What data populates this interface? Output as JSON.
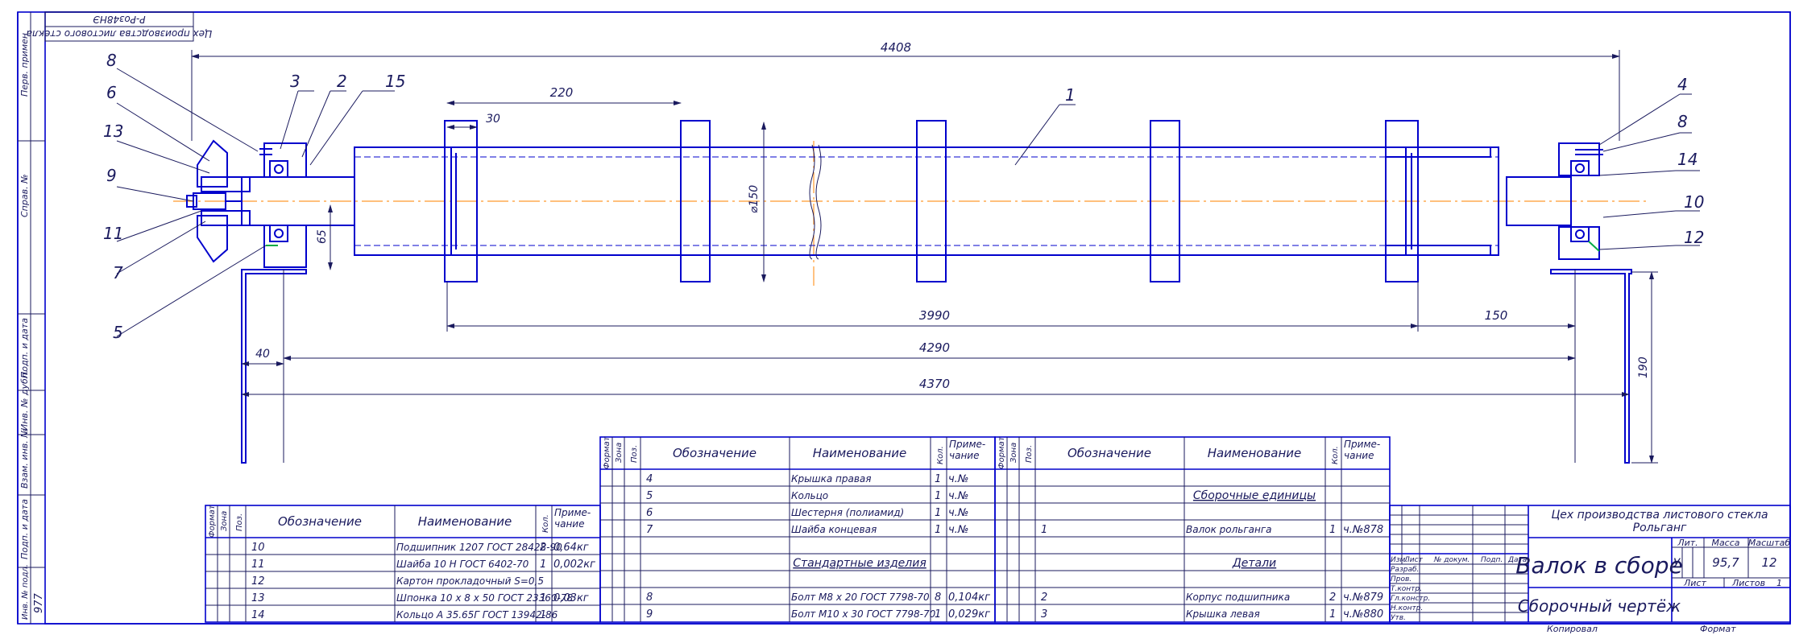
{
  "frame": {
    "top_stamp_line1": "Р-Роз48НЭ",
    "top_stamp_line2": "Цех производства листового стекла",
    "side_labels": [
      "Перв. примен",
      "Справ. №",
      "Подп. и дата",
      "Инв. № дубл.",
      "Взам. инв. №",
      "Подп. и дата",
      "Инв. № подл."
    ],
    "side_value": "977"
  },
  "dimensions": {
    "d4408": "4408",
    "d220": "220",
    "d30": "30",
    "d150dia": "⌀150",
    "d65": "65",
    "d3990": "3990",
    "d150": "150",
    "d40": "40",
    "d4290": "4290",
    "d4370": "4370",
    "d190": "190"
  },
  "callouts": {
    "c1": "1",
    "c2": "2",
    "c3": "3",
    "c4": "4",
    "c5": "5",
    "c6": "6",
    "c7": "7",
    "c8a": "8",
    "c8b": "8",
    "c9": "9",
    "c10": "10",
    "c11": "11",
    "c12": "12",
    "c13": "13",
    "c14": "14",
    "c15": "15"
  },
  "spec_left": {
    "headers": {
      "format": "Формат",
      "zone": "Зона",
      "pos": "Поз.",
      "designation": "Обозначение",
      "name": "Наименование",
      "qty": "Кол.",
      "note": "Приме-чание"
    },
    "rows": [
      {
        "pos": "10",
        "name": "Подшипник 1207 ГОСТ 28428-90",
        "qty": "2",
        "note": "0,64кг"
      },
      {
        "pos": "11",
        "name": "Шайба 10 Н ГОСТ 6402-70",
        "qty": "1",
        "note": "0,002кг"
      },
      {
        "pos": "12",
        "name": "Картон прокладочный S=0,5",
        "qty": "",
        "note": ""
      },
      {
        "pos": "13",
        "name": "Шпонка 10 x 8 x 50 ГОСТ 23360-78",
        "qty": "1",
        "note": "0,03кг"
      },
      {
        "pos": "14",
        "name": "Кольцо А 35.65Г ГОСТ 13942-86",
        "qty": "1",
        "note": ""
      }
    ]
  },
  "spec_mid": {
    "headers": {
      "format": "Формат",
      "zone": "Зона",
      "pos": "Поз.",
      "designation": "Обозначение",
      "name": "Наименование",
      "qty": "Кол.",
      "note": "Приме-чание"
    },
    "rows": [
      {
        "pos": "4",
        "name": "Крышка правая",
        "qty": "1",
        "note": "ч.№"
      },
      {
        "pos": "5",
        "name": "Кольцо",
        "qty": "1",
        "note": "ч.№"
      },
      {
        "pos": "6",
        "name": "Шестерня (полиамид)",
        "qty": "1",
        "note": "ч.№"
      },
      {
        "pos": "7",
        "name": "Шайба концевая",
        "qty": "1",
        "note": "ч.№"
      },
      {
        "pos": "",
        "name": "",
        "qty": "",
        "note": ""
      },
      {
        "pos": "",
        "name": "Стандартные изделия",
        "qty": "",
        "note": ""
      },
      {
        "pos": "",
        "name": "",
        "qty": "",
        "note": ""
      },
      {
        "pos": "8",
        "name": "Болт М8 x 20 ГОСТ 7798-70",
        "qty": "8",
        "note": "0,104кг"
      },
      {
        "pos": "9",
        "name": "Болт М10 x 30 ГОСТ 7798-70",
        "qty": "1",
        "note": "0,029кг"
      }
    ]
  },
  "spec_right": {
    "headers": {
      "format": "Формат",
      "zone": "Зона",
      "pos": "Поз.",
      "designation": "Обозначение",
      "name": "Наименование",
      "qty": "Кол.",
      "note": "Приме-чание"
    },
    "rows": [
      {
        "pos": "",
        "name": "",
        "qty": "",
        "note": ""
      },
      {
        "pos": "",
        "name": "Сборочные единицы",
        "qty": "",
        "note": ""
      },
      {
        "pos": "",
        "name": "",
        "qty": "",
        "note": ""
      },
      {
        "pos": "1",
        "name": "Валок рольганга",
        "qty": "1",
        "note": "ч.№878"
      },
      {
        "pos": "",
        "name": "",
        "qty": "",
        "note": ""
      },
      {
        "pos": "",
        "name": "Детали",
        "qty": "",
        "note": ""
      },
      {
        "pos": "",
        "name": "",
        "qty": "",
        "note": ""
      },
      {
        "pos": "2",
        "name": "Корпус подшипника",
        "qty": "2",
        "note": "ч.№879"
      },
      {
        "pos": "3",
        "name": "Крышка левая",
        "qty": "1",
        "note": "ч.№880"
      }
    ]
  },
  "title_block": {
    "org_line1": "Цех производства листового стекла",
    "org_line2": "Рольганг",
    "title": "Валок в сборе",
    "doc_type": "Сборочный чертёж",
    "lit_label": "Лит.",
    "mass_label": "Масса",
    "scale_label": "Масштаб",
    "lit_value": "У",
    "mass_value": "95,7",
    "scale_value": "12",
    "sheet_label": "Лист",
    "sheets_label": "Листов",
    "sheets_value": "1",
    "col_izm": "Изм.",
    "col_list": "Лист",
    "col_doc": "№ докум.",
    "col_sign": "Подп.",
    "col_date": "Дата",
    "roles": [
      "Разраб.",
      "Пров.",
      "Т.контр.",
      "Гл.констр.",
      "Н.контр.",
      "Утв."
    ],
    "copied": "Копировал",
    "format": "Формат"
  }
}
